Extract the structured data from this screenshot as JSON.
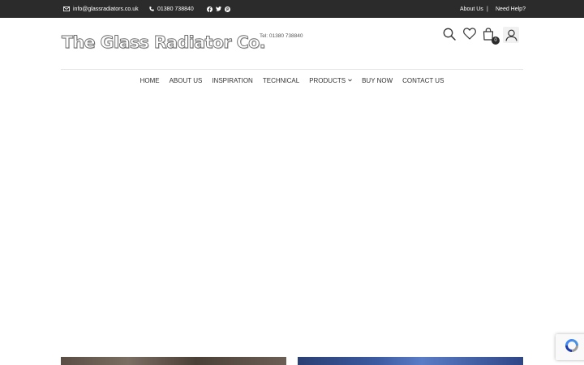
{
  "topbar": {
    "email": "info@glassradiators.co.uk",
    "phone": "01380 738840",
    "social_icons": [
      "facebook-icon",
      "twitter-icon",
      "pinterest-icon"
    ],
    "about_link": "About Us",
    "separator": "|",
    "help_link": "Need Help?"
  },
  "header": {
    "logo_text": "The Glass Radiator Co.",
    "tel": "Tel: 01380 738840",
    "cart_count": "0",
    "icons": [
      "search-icon",
      "heart-icon",
      "cart-icon",
      "user-icon"
    ]
  },
  "nav": {
    "items": [
      {
        "label": "HOME"
      },
      {
        "label": "ABOUT US"
      },
      {
        "label": "INSPIRATION"
      },
      {
        "label": "TECHNICAL"
      },
      {
        "label": "PRODUCTS",
        "dropdown": true
      },
      {
        "label": "BUY NOW"
      },
      {
        "label": "CONTACT US"
      }
    ]
  },
  "colors": {
    "topbar_bg": "#2b2b2b",
    "accent": "#2b2b2b"
  }
}
